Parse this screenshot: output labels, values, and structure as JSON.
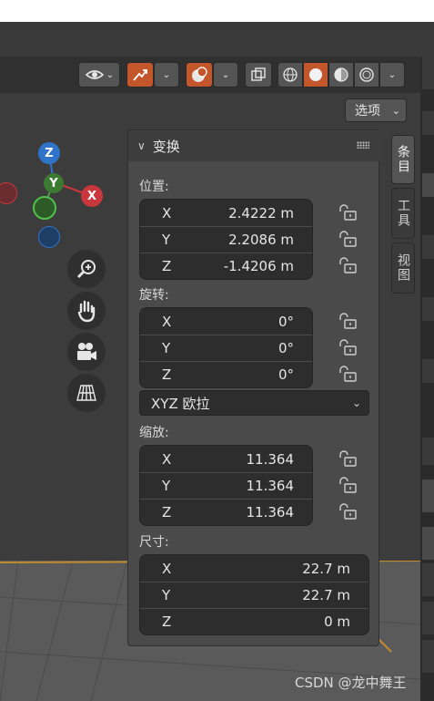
{
  "header": {
    "buttons": [
      {
        "name": "visibility-dropdown",
        "icon": "eye-icon"
      },
      {
        "name": "gizmo-toggle",
        "icon": "gizmo-arrow-icon"
      },
      {
        "name": "overlays-toggle",
        "icon": "overlay-circles-icon"
      },
      {
        "name": "xray-toggle",
        "icon": "xray-square-icon"
      },
      {
        "name": "shading-wireframe",
        "icon": "wireframe-sphere-icon"
      },
      {
        "name": "shading-solid",
        "icon": "solid-sphere-icon"
      },
      {
        "name": "shading-material",
        "icon": "material-sphere-icon"
      },
      {
        "name": "shading-rendered",
        "icon": "rendered-sphere-icon"
      }
    ]
  },
  "options_label": "选项",
  "gizmo": {
    "z": "Z",
    "y": "Y",
    "x": "X"
  },
  "side_tabs": [
    "条目",
    "工具",
    "视图"
  ],
  "panel": {
    "title": "变换",
    "location": {
      "label": "位置:",
      "rows": [
        {
          "axis": "X",
          "value": "2.4222 m"
        },
        {
          "axis": "Y",
          "value": "2.2086 m"
        },
        {
          "axis": "Z",
          "value": "-1.4206 m"
        }
      ]
    },
    "rotation": {
      "label": "旋转:",
      "rows": [
        {
          "axis": "X",
          "value": "0°"
        },
        {
          "axis": "Y",
          "value": "0°"
        },
        {
          "axis": "Z",
          "value": "0°"
        }
      ],
      "mode": "XYZ 欧拉"
    },
    "scale": {
      "label": "缩放:",
      "rows": [
        {
          "axis": "X",
          "value": "11.364"
        },
        {
          "axis": "Y",
          "value": "11.364"
        },
        {
          "axis": "Z",
          "value": "11.364"
        }
      ]
    },
    "dimensions": {
      "label": "尺寸:",
      "rows": [
        {
          "axis": "X",
          "value": "22.7 m"
        },
        {
          "axis": "Y",
          "value": "22.7 m"
        },
        {
          "axis": "Z",
          "value": "0 m"
        }
      ]
    }
  },
  "watermark": "CSDN @龙中舞王",
  "colors": {
    "accent": "#c4562c",
    "x_axis": "#c8373b",
    "y_axis": "#4f9a3c",
    "z_axis": "#2f74c9"
  }
}
